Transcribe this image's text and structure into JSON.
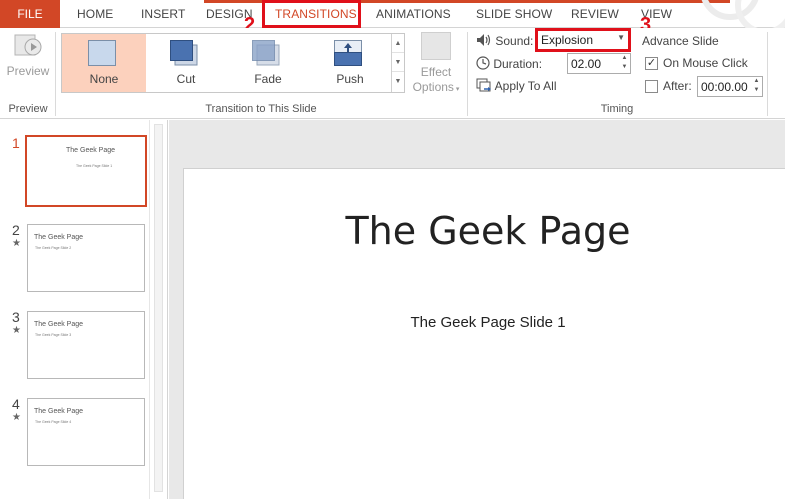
{
  "tabs": {
    "file": "FILE",
    "home": "HOME",
    "insert": "INSERT",
    "design": "DESIGN",
    "transitions": "TRANSITIONS",
    "animations": "ANIMATIONS",
    "slide_show": "SLIDE SHOW",
    "review": "REVIEW",
    "view": "VIEW"
  },
  "ribbon": {
    "preview_group": {
      "button_label": "Preview",
      "group_label": "Preview"
    },
    "transition_group": {
      "group_label": "Transition to This Slide",
      "items": [
        {
          "label": "None",
          "selected": true
        },
        {
          "label": "Cut",
          "selected": false
        },
        {
          "label": "Fade",
          "selected": false
        },
        {
          "label": "Push",
          "selected": false
        }
      ],
      "effect_options_line1": "Effect",
      "effect_options_line2": "Options"
    },
    "timing": {
      "group_label": "Timing",
      "sound_label": "Sound:",
      "sound_value": "Explosion",
      "duration_label": "Duration:",
      "duration_value": "02.00",
      "apply_to_all": "Apply To All",
      "advance_slide": "Advance Slide",
      "on_mouse_click": "On Mouse Click",
      "on_mouse_click_checked": true,
      "after_label": "After:",
      "after_value": "00:00.00",
      "after_checked": false
    }
  },
  "slides": [
    {
      "number": "1",
      "title": "The Geek Page",
      "subtitle": "The Geek Page Slide 1",
      "has_transition_star": false,
      "active": true
    },
    {
      "number": "2",
      "title": "The Geek Page",
      "subtitle": "The Geek Page Slide 2",
      "has_transition_star": true,
      "active": false
    },
    {
      "number": "3",
      "title": "The Geek Page",
      "subtitle": "The Geek Page Slide 3",
      "has_transition_star": true,
      "active": false
    },
    {
      "number": "4",
      "title": "The Geek Page",
      "subtitle": "The Geek Page Slide 4",
      "has_transition_star": true,
      "active": false
    }
  ],
  "annotations": {
    "a1": "1",
    "a2": "2",
    "a3": "3"
  },
  "main_slide": {
    "title": "The Geek Page",
    "subtitle": "The Geek Page Slide 1"
  },
  "colors": {
    "accent": "#d24726",
    "highlight_box": "#e0101a",
    "selected_gallery": "#fcd1bd"
  }
}
